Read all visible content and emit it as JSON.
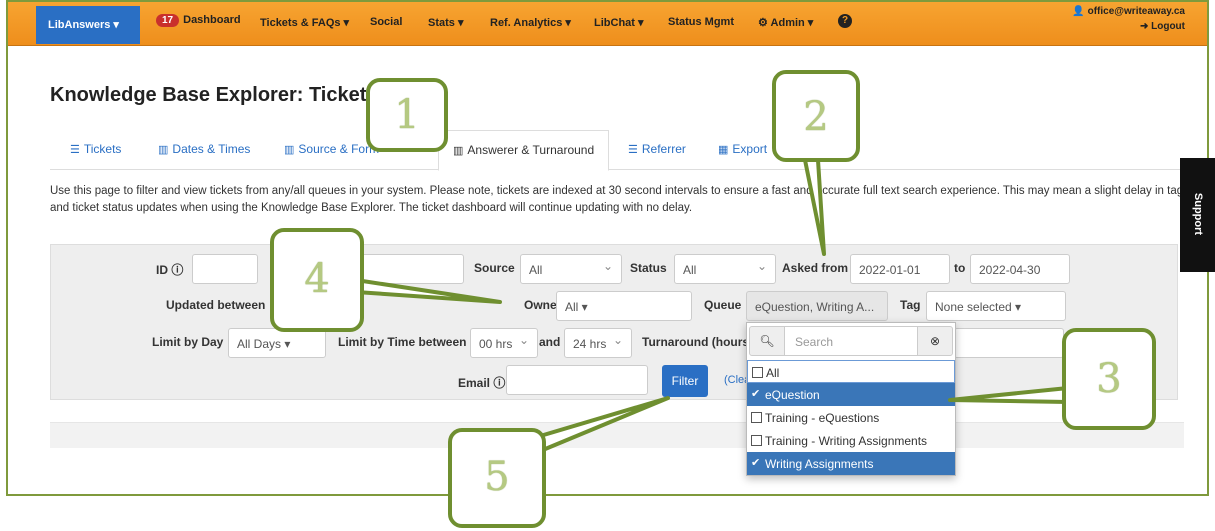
{
  "nav": {
    "brand": "LibAnswers ▾",
    "dashboard_count": "17",
    "dashboard": "Dashboard",
    "tickets_faqs": "Tickets & FAQs ▾",
    "social": "Social",
    "stats": "Stats ▾",
    "ref_analytics": "Ref. Analytics ▾",
    "libchat": "LibChat ▾",
    "status_mgmt": "Status Mgmt",
    "admin": "Admin ▾",
    "help_icon": "?",
    "user_email": "office@writeaway.ca",
    "logout": "Logout"
  },
  "page": {
    "title": "Knowledge Base Explorer: Tickets",
    "description": "Use this page to filter and view tickets from any/all queues in your system. Please note, tickets are indexed at 30 second intervals to ensure a fast and accurate full text search experience. This may mean a slight delay in tag and ticket status updates when using the Knowledge Base Explorer. The ticket dashboard will continue updating with no delay."
  },
  "tabs": [
    {
      "label": "Tickets"
    },
    {
      "label": "Dates & Times"
    },
    {
      "label": "Source & Form"
    },
    {
      "label": "Answerer & Turnaround"
    },
    {
      "label": "Referrer"
    },
    {
      "label": "Export"
    }
  ],
  "filters": {
    "id_label": "ID",
    "source_label": "Source",
    "source_value": "All",
    "status_label": "Status",
    "status_value": "All",
    "asked_from_label": "Asked from",
    "asked_from_value": "2022-01-01",
    "to_label": "to",
    "to_value": "2022-04-30",
    "updated_between_label": "Updated between",
    "owner_label": "Owner",
    "owner_value": "All ▾",
    "queue_label": "Queue",
    "queue_value": "eQuestion, Writing A...",
    "tag_label": "Tag",
    "tag_value": "None selected ▾",
    "limit_day_label": "Limit by Day",
    "limit_day_value": "All Days ▾",
    "limit_time_label": "Limit by Time between",
    "time_from": "00 hrs",
    "and_label": "and",
    "time_to": "24 hrs",
    "turnaround_label": "Turnaround (hours)",
    "email_label": "Email",
    "filter_button": "Filter",
    "clear_link": "(Clea"
  },
  "queue_dropdown": {
    "search_placeholder": "Search",
    "options": [
      {
        "label": "All",
        "checked": false
      },
      {
        "label": "eQuestion",
        "checked": true
      },
      {
        "label": "Training - eQuestions",
        "checked": false
      },
      {
        "label": "Training - Writing Assignments",
        "checked": false
      },
      {
        "label": "Writing Assignments",
        "checked": true
      }
    ]
  },
  "support_tab": "Support",
  "callouts": [
    "1",
    "2",
    "3",
    "4",
    "5"
  ],
  "colors": {
    "navbar": "#f39a25",
    "brand": "#2a6fc4",
    "callout_border": "#6f8f30",
    "selected_option": "#3a76b8"
  }
}
